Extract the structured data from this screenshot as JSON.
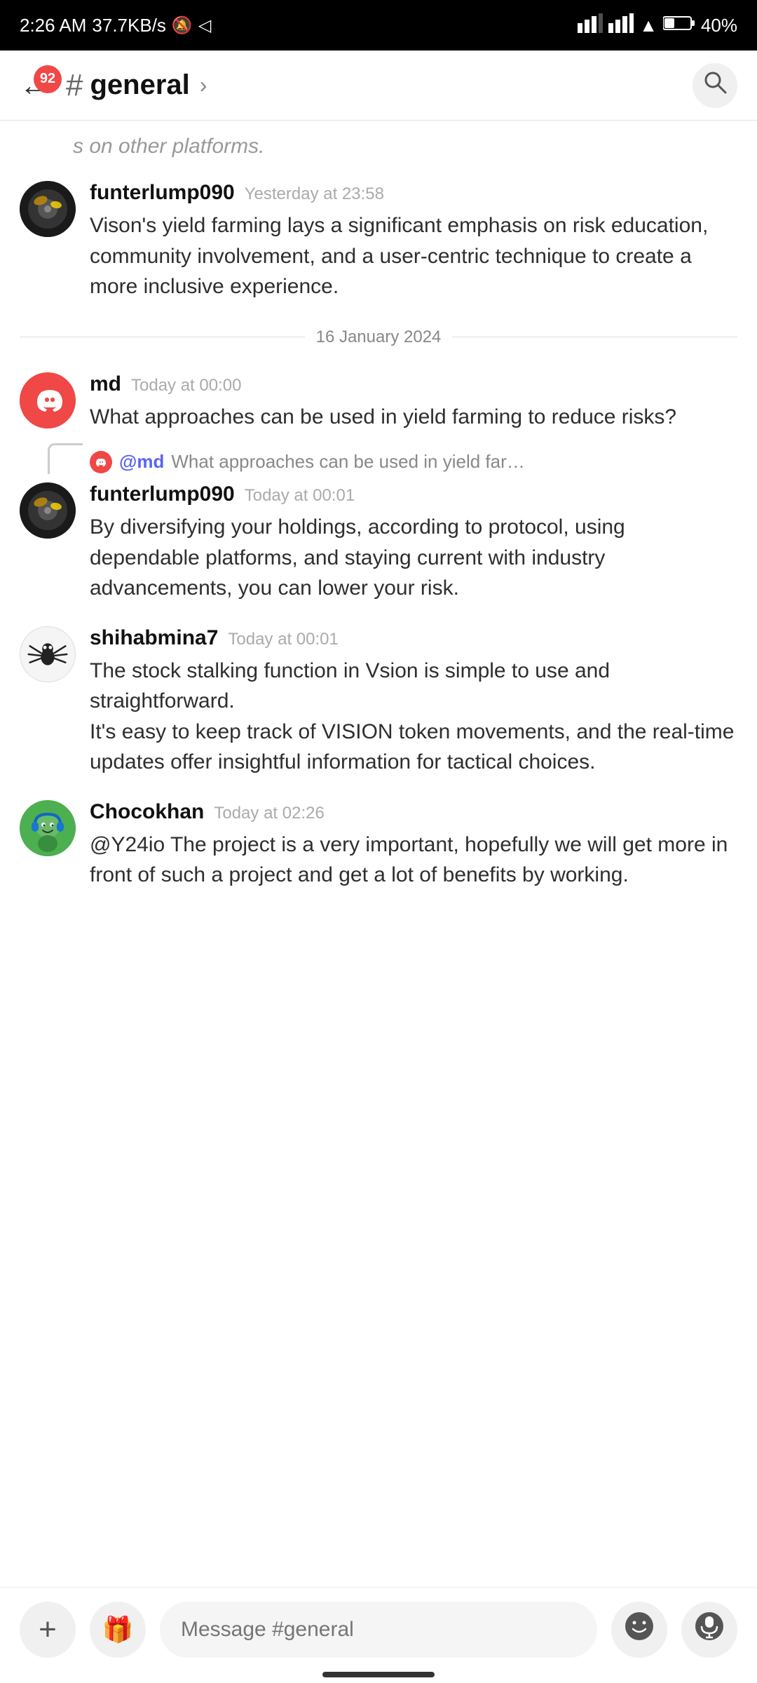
{
  "statusBar": {
    "time": "2:26 AM",
    "network": "37.7KB/s",
    "battery": "40%"
  },
  "header": {
    "badge": "92",
    "channelHash": "#",
    "channelName": "general",
    "chevron": "›"
  },
  "truncated": "s on other platforms.",
  "dateDivider": "16 January 2024",
  "messages": [
    {
      "id": "msg1",
      "username": "funterlump090",
      "timestamp": "Yesterday at 23:58",
      "text": "Vison's yield farming lays a significant emphasis on risk education, community involvement, and a user-centric technique to create a more inclusive experience.",
      "avatar": "funterlump"
    },
    {
      "id": "msg2",
      "username": "md",
      "timestamp": "Today at 00:00",
      "text": "What approaches can be used in yield farming to reduce risks?",
      "avatar": "md"
    },
    {
      "id": "msg3",
      "username": "funterlump090",
      "timestamp": "Today at 00:01",
      "text": "By diversifying your holdings, according to protocol, using dependable platforms, and staying current with industry advancements, you can lower your risk.",
      "avatar": "funterlump",
      "replyTo": {
        "mention": "@md",
        "preview": "What approaches can be used in yield farming to r educe risks?"
      }
    },
    {
      "id": "msg4",
      "username": "shihabmina7",
      "timestamp": "Today at 00:01",
      "text": "The stock stalking function in Vsion is simple to use and straightforward.\nIt's easy to keep track of VISION token movements, and the real-time updates offer insightful information for tactical choices.",
      "avatar": "spider"
    },
    {
      "id": "msg5",
      "username": "Chocokhan",
      "timestamp": "Today at 02:26",
      "text": "@Y24io The project is a very important, hopefully we will get more in front of such a project and get a lot of benefits by working.",
      "avatar": "chocokhan"
    }
  ],
  "inputBar": {
    "placeholder": "Message #general"
  },
  "buttons": {
    "plus": "+",
    "gift": "🎁",
    "emoji": "🙂",
    "mic": "🎤"
  }
}
